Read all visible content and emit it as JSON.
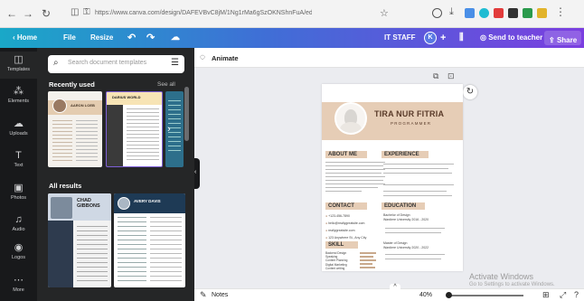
{
  "browser": {
    "url": "https://www.canva.com/design/DAFEVBvC8jM/1Ng1rMa6gSzOKNShnFuA/edit"
  },
  "topbar": {
    "home": "Home",
    "file": "File",
    "resize": "Resize",
    "team": "IT STAFF",
    "avatar_initial": "K",
    "send": "Send to teacher",
    "share": "Share"
  },
  "rail": {
    "items": [
      "Templates",
      "Elements",
      "Uploads",
      "Text",
      "Photos",
      "Audio",
      "Logos",
      "More"
    ]
  },
  "panel": {
    "search_placeholder": "Search document templates",
    "recent_title": "Recently used",
    "see_all": "See all",
    "all_results": "All results",
    "thumb1_name": "AARON LOEB",
    "thumb2_name": "DARIUS WORLD",
    "thumb3_name": "CHAD GIBBONS",
    "thumb4_name": "AVERY DAVIS"
  },
  "canvas": {
    "animate": "Animate",
    "notes": "Notes",
    "zoom": "40%",
    "watermark_title": "Activate Windows",
    "watermark_sub": "Go to Settings to activate Windows."
  },
  "resume": {
    "name": "TIRA NUR FITRIA",
    "role": "PROGRAMMER",
    "about": "ABOUT ME",
    "experience": "EXPERIENCE",
    "contact": "CONTACT",
    "education": "EDUCATION",
    "skill": "SKILL",
    "contact_items": [
      "+123-456-7890",
      "hello@reallygreatsite.com",
      "reallygreatsite.com",
      "123 Anywhere St., Any City"
    ],
    "skills": [
      "Backend Design",
      "Speaking",
      "Content Planning",
      "Digital Marketing",
      "Content writing"
    ],
    "edu_title_1": "Bachelor of Design",
    "edu_school_1": "Wardiere University 2016 - 2020",
    "edu_title_2": "Master of Design",
    "edu_school_2": "Wardiere University 2020 - 2022"
  },
  "colors": {
    "accent": "#e6cdb6",
    "topbar_start": "#1aa8c8",
    "topbar_end": "#7b3ee0"
  }
}
